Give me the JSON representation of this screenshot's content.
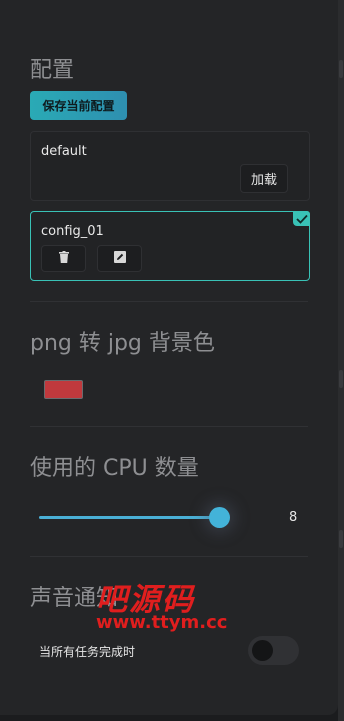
{
  "config": {
    "title": "配置",
    "save_button": "保存当前配置",
    "profiles": [
      {
        "name": "default",
        "load_label": "加载",
        "selected": false
      },
      {
        "name": "config_01",
        "selected": true
      }
    ]
  },
  "png_bg": {
    "title": "png 转 jpg 背景色",
    "color": "#c0393d"
  },
  "cpu": {
    "title": "使用的 CPU 数量",
    "value": "8",
    "fill_fraction": 1.0
  },
  "sound": {
    "title": "声音通知",
    "toggle_label": "当所有任务完成时",
    "enabled": false
  },
  "watermark": {
    "text": "吧源码",
    "url": "www.ttym.cc"
  },
  "icons": {
    "check": "check-icon",
    "delete": "trash-icon",
    "edit": "edit-icon"
  },
  "colors": {
    "accent": "#39c2b6",
    "slider": "#43b3d9"
  }
}
